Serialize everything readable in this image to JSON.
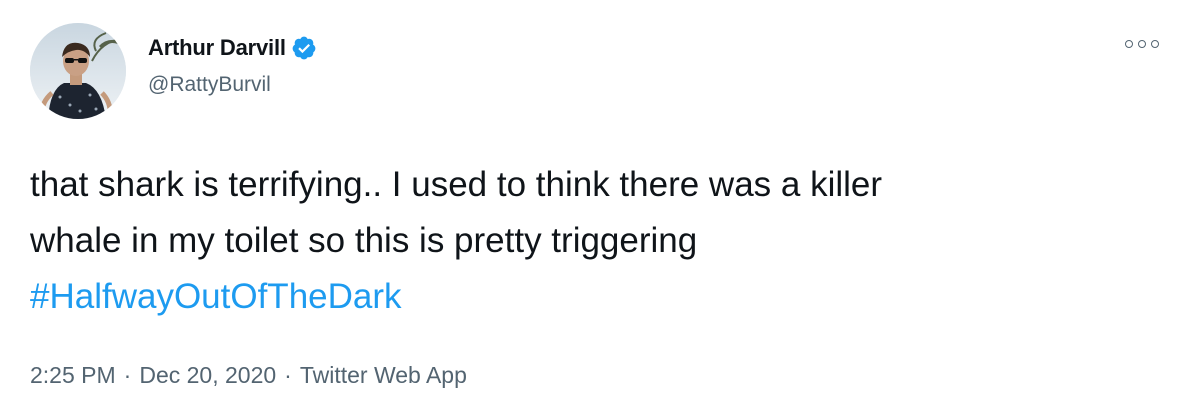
{
  "author": {
    "display_name": "Arthur Darvill",
    "handle": "@RattyBurvil",
    "verified": true,
    "avatar_icon": "profile-photo"
  },
  "more_icon": "more-options-icon",
  "tweet": {
    "line1": "that shark is terrifying.. I used to think there was a killer",
    "line2": "whale in my toilet so this is pretty triggering",
    "hashtag": "#HalfwayOutOfTheDark"
  },
  "meta": {
    "time": "2:25 PM",
    "date": "Dec 20, 2020",
    "source": "Twitter Web App",
    "separator": "·"
  },
  "colors": {
    "text": "#0f1419",
    "secondary": "#536471",
    "link": "#1d9bf0",
    "verified_badge": "#1d9bf0"
  }
}
